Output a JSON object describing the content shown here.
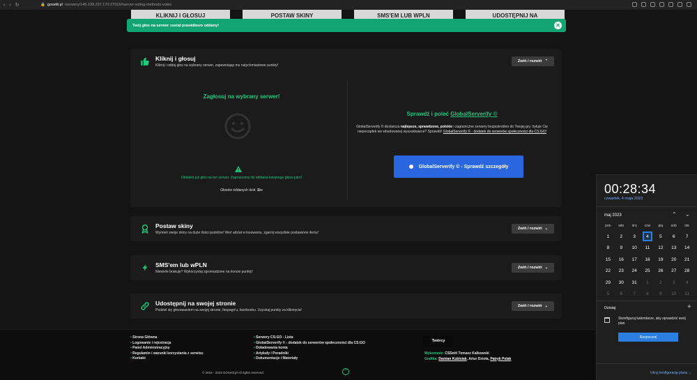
{
  "browser": {
    "url_domain": "gosetti.pl",
    "url_path": "/serwery/145.239.237.170:27015#server-voting-methods-votes"
  },
  "top_buttons": [
    "KLIKNIJ I GŁOSUJ",
    "POSTAW SKINY",
    "SMS'EM LUB WPLN",
    "UDOSTĘPNIJ NA"
  ],
  "toast": {
    "message": "Twój głos na serwer został prawidłowo oddany!",
    "close_icon": "close-icon"
  },
  "cards": {
    "vote": {
      "title": "Kliknij i głosuj",
      "subtitle": "Kliknij i oddaj głos na wybrany serwer, zapewniając mu natychmiastowe punkty!",
      "toggle": "Zwiń / rozwiń",
      "icon": "thumbs-up-icon",
      "left_title": "Zagłosuj na wybrany serwer!",
      "info": "Oddałeś już głos na ten serwer. Zapraszamy do oddania kolejnego głosu jutro!",
      "count_label": "Głosów oddanych dziś:",
      "count_value": "1/∞",
      "right_title_prefix": "Sprawdź i poleć",
      "right_title_link": "GlobalServerify ©",
      "desc_1": "GlobalServerify © dostarcza",
      "desc_bold": "najlepsze, sprawdzone, polskie",
      "desc_2": "i zagraniczne serwery bezpośrednio do Twojej gry. Irytuje Cię nieporządek we wbudowanej wyszukiwarce? Sprawdź!",
      "desc_link": "GlobalServerify © - dodatek do serwerów społeczności dla CS:GO!",
      "cta": "GlobalServerify © - Sprawdź szczegóły"
    },
    "skins": {
      "title": "Postaw skiny",
      "subtitle": "Wymień swoje skiny na duże ilości punktów! Weź udział w losowaniu, zgarnij wszystkie postawione itemy!",
      "toggle": "Zwiń / rozwiń",
      "icon": "award-icon"
    },
    "sms": {
      "title": "SMS'em lub wPLN",
      "subtitle": "Niewiele brakuje? Wykorzystaj zgromadzone na koncie punkty!",
      "toggle": "Zwiń / rozwiń",
      "icon": "lightning-icon"
    },
    "share": {
      "title": "Udostępnij na swojej stronie",
      "subtitle": "Podziel się głosowaniem na swojej stronie, fanpage'u, facebooku. Uzyskaj punkty za kliknięcia!",
      "toggle": "Zwiń / rozwiń",
      "icon": "link-icon"
    }
  },
  "footer": {
    "col1": [
      "Strona Główna",
      "Logowanie i rejestracja",
      "Panel Administracyjny",
      "Regulamin i warunki korzystania z serwisu",
      "Kontakt"
    ],
    "col2": [
      "Serwery CS:GO - Lista",
      "GlobalServerify © - dodatek do serwerów społeczności dla CS:GO",
      "Doładowania konta",
      "Artykuły i Poradniki",
      "Dokumentacje i Materiały"
    ],
    "creators_button": "Twórcy",
    "impl_label": "Wykonanie:",
    "impl_value": "CSSetti Tomasz Kalkowski",
    "graphics_label": "Grafika:",
    "graphics_1": "Damian Kubisiak",
    "graphics_2": "Artur Dzioła",
    "graphics_3": "Patryk Polak",
    "copyright": "© 2016 - 2023 GOSetti.pl All rights reserved."
  },
  "calendar": {
    "time": "00:28:34",
    "date": "czwartek, 4 maja 2023",
    "month": "maj 2023",
    "weekdays": [
      "pon",
      "wto",
      "śro",
      "czw",
      "pią",
      "sob",
      "nie"
    ],
    "days": [
      {
        "d": "1"
      },
      {
        "d": "2"
      },
      {
        "d": "3"
      },
      {
        "d": "4",
        "today": true
      },
      {
        "d": "5"
      },
      {
        "d": "6"
      },
      {
        "d": "7"
      },
      {
        "d": "8"
      },
      {
        "d": "9"
      },
      {
        "d": "10"
      },
      {
        "d": "11"
      },
      {
        "d": "12"
      },
      {
        "d": "13"
      },
      {
        "d": "14"
      },
      {
        "d": "15"
      },
      {
        "d": "16"
      },
      {
        "d": "17"
      },
      {
        "d": "18"
      },
      {
        "d": "19"
      },
      {
        "d": "20"
      },
      {
        "d": "21"
      },
      {
        "d": "22"
      },
      {
        "d": "23"
      },
      {
        "d": "24"
      },
      {
        "d": "25"
      },
      {
        "d": "26"
      },
      {
        "d": "27"
      },
      {
        "d": "28"
      },
      {
        "d": "29"
      },
      {
        "d": "30"
      },
      {
        "d": "31"
      },
      {
        "d": "1",
        "other": true
      },
      {
        "d": "2",
        "other": true
      },
      {
        "d": "3",
        "other": true
      },
      {
        "d": "4",
        "other": true
      },
      {
        "d": "5",
        "other": true
      },
      {
        "d": "6",
        "other": true
      },
      {
        "d": "7",
        "other": true
      },
      {
        "d": "8",
        "other": true
      },
      {
        "d": "9",
        "other": true
      },
      {
        "d": "10",
        "other": true
      },
      {
        "d": "11",
        "other": true
      }
    ],
    "agenda_heading": "Dzisiaj",
    "agenda_text": "Skonfiguruj kalendarze, aby sprawdzić swój plan",
    "start_button": "Rozpocznij",
    "hide_plan": "Ukryj konfigurację planu"
  }
}
